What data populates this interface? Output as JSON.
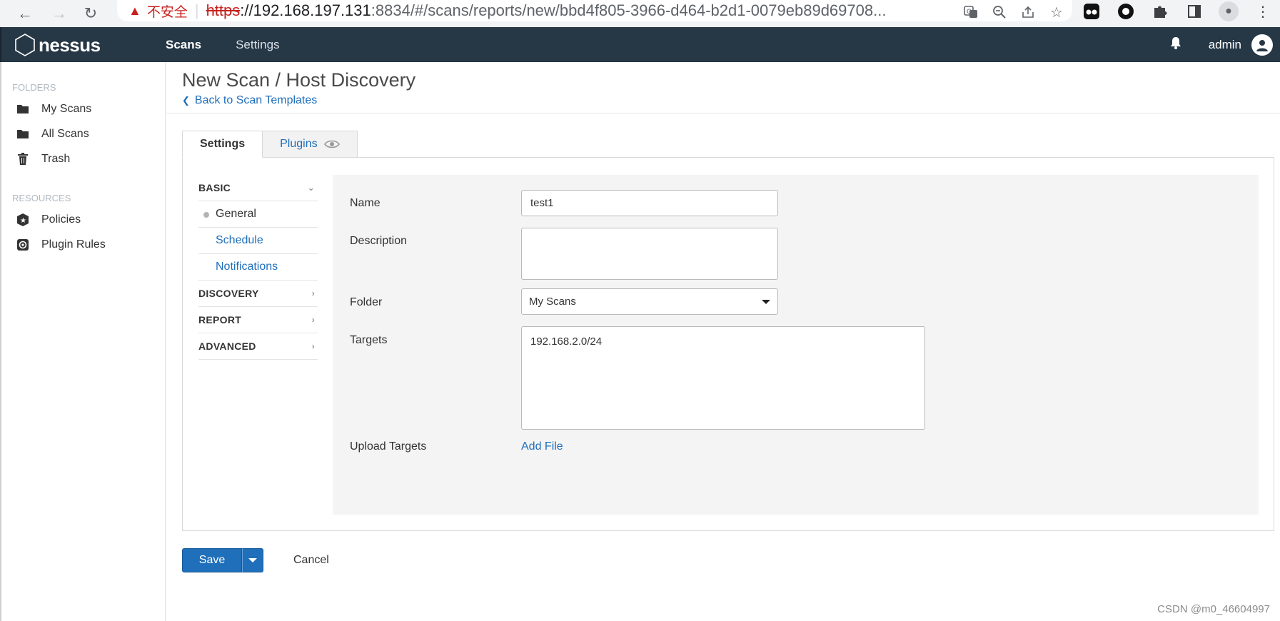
{
  "browser": {
    "insecure_label": "不安全",
    "url_scheme": "https",
    "url_host": "://192.168.197.131",
    "url_path": ":8834/#/scans/reports/new/bbd4f805-3966-d464-b2d1-0079eb89d69708..."
  },
  "app": {
    "logo": "nessus",
    "nav": {
      "scans": "Scans",
      "settings": "Settings"
    },
    "user": "admin"
  },
  "sidebar": {
    "folders_heading": "FOLDERS",
    "folders": [
      {
        "label": "My Scans",
        "icon": "folder-icon"
      },
      {
        "label": "All Scans",
        "icon": "folder-icon"
      },
      {
        "label": "Trash",
        "icon": "trash-icon"
      }
    ],
    "resources_heading": "RESOURCES",
    "resources": [
      {
        "label": "Policies",
        "icon": "shield-icon"
      },
      {
        "label": "Plugin Rules",
        "icon": "plugin-rules-icon"
      }
    ]
  },
  "page": {
    "title": "New Scan / Host Discovery",
    "back_link": "Back to Scan Templates",
    "tabs": {
      "settings": "Settings",
      "plugins": "Plugins"
    }
  },
  "subnav": {
    "basic": "BASIC",
    "basic_items": [
      "General",
      "Schedule",
      "Notifications"
    ],
    "discovery": "DISCOVERY",
    "report": "REPORT",
    "advanced": "ADVANCED"
  },
  "form": {
    "name_label": "Name",
    "name_value": "test1",
    "description_label": "Description",
    "description_value": "",
    "folder_label": "Folder",
    "folder_value": "My Scans",
    "targets_label": "Targets",
    "targets_value": "192.168.2.0/24",
    "upload_label": "Upload Targets",
    "add_file": "Add File"
  },
  "actions": {
    "save": "Save",
    "cancel": "Cancel"
  },
  "watermark": "CSDN @m0_46604997",
  "colors": {
    "topbar": "#263746",
    "link": "#1f6fba",
    "primary_button": "#1f6fba",
    "form_bg": "#f4f4f4"
  }
}
